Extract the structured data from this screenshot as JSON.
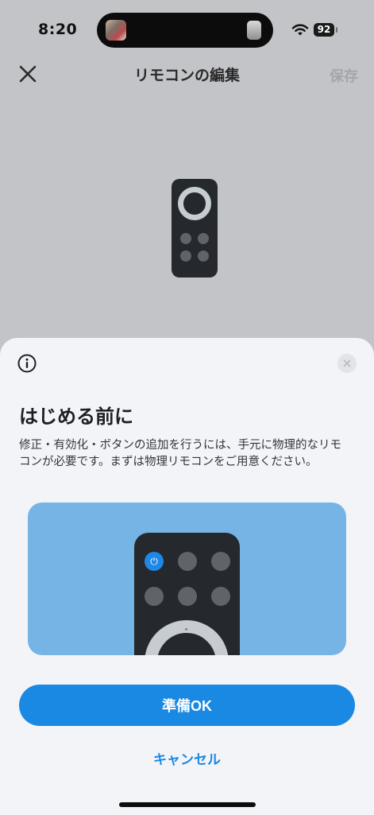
{
  "status_bar": {
    "time": "8:20",
    "battery": "92",
    "wifi_icon": "wifi-icon"
  },
  "header": {
    "close_icon": "close-icon",
    "title": "リモコンの編集",
    "save_label": "保存"
  },
  "sheet": {
    "info_icon": "info-icon",
    "dismiss_icon": "close-icon",
    "title": "はじめる前に",
    "description": "修正・有効化・ボタンの追加を行うには、手元に物理的なリモコンが必要です。まずは物理リモコンをご用意ください。",
    "power_icon": "power-icon",
    "primary_button": "準備OK",
    "cancel_button": "キャンセル"
  },
  "colors": {
    "accent": "#1989e3",
    "illustration_bg": "#77b4e6",
    "remote_body": "#25292d",
    "overlay_bg": "#c3c4c7",
    "sheet_bg": "#f3f4f8"
  }
}
